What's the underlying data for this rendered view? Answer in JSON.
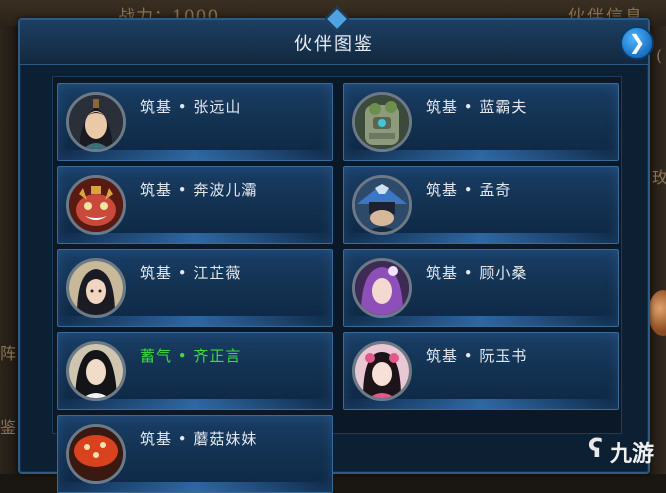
{
  "background": {
    "power_label": "战力：1000",
    "partner_info": "伙伴信息",
    "left_char_1": "阵",
    "left_char_2": "鉴",
    "right_char_1": "玫",
    "right_char_2": "("
  },
  "panel": {
    "title": "伙伴图鉴",
    "close_glyph": "❯"
  },
  "partners": [
    {
      "name": "筑基 • 张远山",
      "highlight": false,
      "portrait": "young-man-topknot"
    },
    {
      "name": "筑基 • 蓝霸夫",
      "highlight": false,
      "portrait": "stone-golem"
    },
    {
      "name": "筑基 • 奔波儿灞",
      "highlight": false,
      "portrait": "red-beast"
    },
    {
      "name": "筑基 • 孟奇",
      "highlight": false,
      "portrait": "straw-hat-swordsman"
    },
    {
      "name": "筑基 • 江芷薇",
      "highlight": false,
      "portrait": "dark-haired-woman"
    },
    {
      "name": "筑基 • 顾小桑",
      "highlight": false,
      "portrait": "purple-haired-woman"
    },
    {
      "name": "蓄气 • 齐正言",
      "highlight": true,
      "portrait": "long-haired-man"
    },
    {
      "name": "筑基 • 阮玉书",
      "highlight": false,
      "portrait": "pink-girl"
    },
    {
      "name": "筑基 • 蘑菇妹妹",
      "highlight": false,
      "portrait": "mushroom-girl"
    }
  ],
  "colors": {
    "highlight_name": "#3fdc3f",
    "normal_name": "#e4e8ee",
    "panel_border": "#2f5b82"
  },
  "watermark": {
    "icon": "九游-logo-icon",
    "text": "九游"
  }
}
